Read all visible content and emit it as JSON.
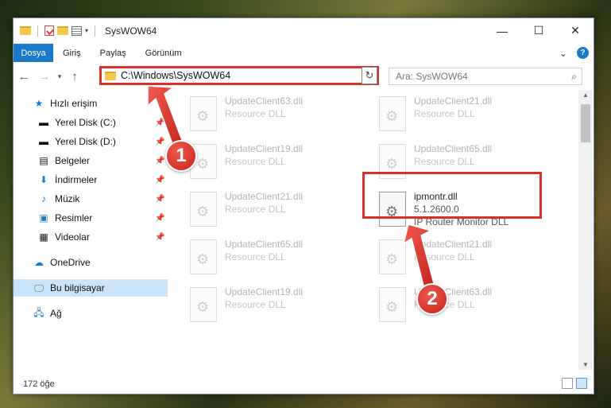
{
  "window": {
    "title": "SysWOW64",
    "minimize": "—",
    "maximize": "☐",
    "close": "✕"
  },
  "ribbon": {
    "tabs": [
      "Dosya",
      "Giriş",
      "Paylaş",
      "Görünüm"
    ],
    "help": "?",
    "expand": "⌄"
  },
  "address": {
    "path": "C:\\Windows\\SysWOW64",
    "search_placeholder": "Ara: SysWOW64"
  },
  "nav": {
    "quick_access": "Hızlı erişim",
    "items": [
      {
        "label": "Yerel Disk (C:)",
        "icon": "drive-icon"
      },
      {
        "label": "Yerel Disk (D:)",
        "icon": "drive-icon"
      },
      {
        "label": "Belgeler",
        "icon": "documents-icon"
      },
      {
        "label": "İndirmeler",
        "icon": "download-icon"
      },
      {
        "label": "Müzik",
        "icon": "music-icon"
      },
      {
        "label": "Resimler",
        "icon": "pictures-icon"
      },
      {
        "label": "Videolar",
        "icon": "videos-icon"
      }
    ],
    "onedrive": "OneDrive",
    "this_pc": "Bu bilgisayar",
    "network": "Ağ"
  },
  "files": [
    {
      "name": "UpdateClient63.dll",
      "desc": "Resource DLL"
    },
    {
      "name": "UpdateClient21.dll",
      "desc": "Resource DLL"
    },
    {
      "name": "UpdateClient19.dll",
      "desc": "Resource DLL"
    },
    {
      "name": "UpdateClient65.dll",
      "desc": "Resource DLL"
    },
    {
      "name": "UpdateClient21.dll",
      "desc": "Resource DLL"
    },
    {
      "name": "ipmontr.dll",
      "version": "5.1.2600.0",
      "desc": "IP Router Monitor DLL"
    },
    {
      "name": "UpdateClient65.dll",
      "desc": "Resource DLL"
    },
    {
      "name": "UpdateClient21.dll",
      "desc": "Resource DLL"
    },
    {
      "name": "UpdateClient19.dll",
      "desc": "Resource DLL"
    },
    {
      "name": "UpdateClient63.dll",
      "desc": "Resource DLL"
    }
  ],
  "status": {
    "count": "172 öğe"
  },
  "badges": {
    "one": "1",
    "two": "2"
  },
  "colors": {
    "accent": "#1979ca",
    "highlight": "#d9302a"
  }
}
